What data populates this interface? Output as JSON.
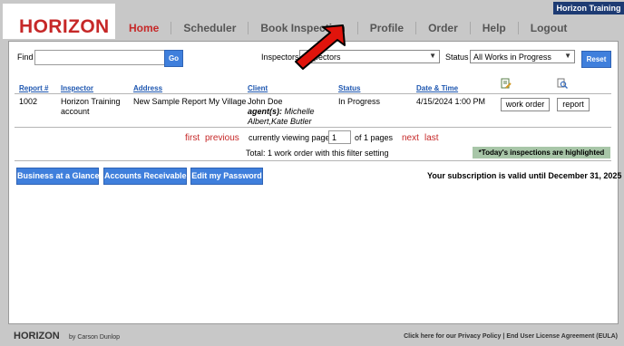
{
  "header": {
    "brand": "HORIZON",
    "account": "Horizon Training",
    "nav": [
      "Home",
      "Scheduler",
      "Book Inspection",
      "Profile",
      "Order",
      "Help",
      "Logout"
    ],
    "active_nav": "Home"
  },
  "filters": {
    "find_label": "Find",
    "find_value": "",
    "go_label": "Go",
    "inspectors_label": "Inspectors",
    "inspectors_value": "Inspectors",
    "status_label": "Status",
    "status_value": "All Works in Progress",
    "reset_label": "Reset"
  },
  "table": {
    "columns": [
      "Report #",
      "Inspector",
      "Address",
      "Client",
      "Status",
      "Date & Time"
    ],
    "rows": [
      {
        "report": "1002",
        "inspector_line1": "Horizon Training",
        "inspector_line2": "account",
        "address": "New Sample Report My Village",
        "client_name": "John Doe",
        "agents_label": "agent(s):",
        "agents_line1": "Michelle",
        "agents_line2": "Albert,Kate Butler",
        "status": "In Progress",
        "datetime": "4/15/2024 1:00 PM",
        "work_order_label": "work order",
        "report_label": "report"
      }
    ]
  },
  "pagination": {
    "first": "first",
    "previous": "previous",
    "viewing_text": "currently viewing page",
    "page": "1",
    "of_pages": "of 1 pages",
    "next": "next",
    "last": "last",
    "total": "Total: 1 work order with this filter setting",
    "highlight_note": "*Today's inspections are highlighted"
  },
  "actions": [
    "Business at a Glance",
    "Accounts Receivable",
    "Edit my Password"
  ],
  "subscription": "Your subscription is valid until December 31, 2025",
  "footer": {
    "brand": "HORIZON",
    "by": "by Carson Dunlop",
    "privacy": "Click here for our Privacy Policy",
    "separator": "|",
    "eula": "End User License Agreement (EULA)"
  },
  "colors": {
    "brand_red": "#c62828",
    "nav_blue": "#1d3b73",
    "button_blue": "#3f7fdc",
    "link_blue": "#1d56b0",
    "highlight_green": "#a8c6a8",
    "annotation_arrow": "#e0140c"
  },
  "icons": [
    "edit-document-icon",
    "view-report-icon"
  ]
}
